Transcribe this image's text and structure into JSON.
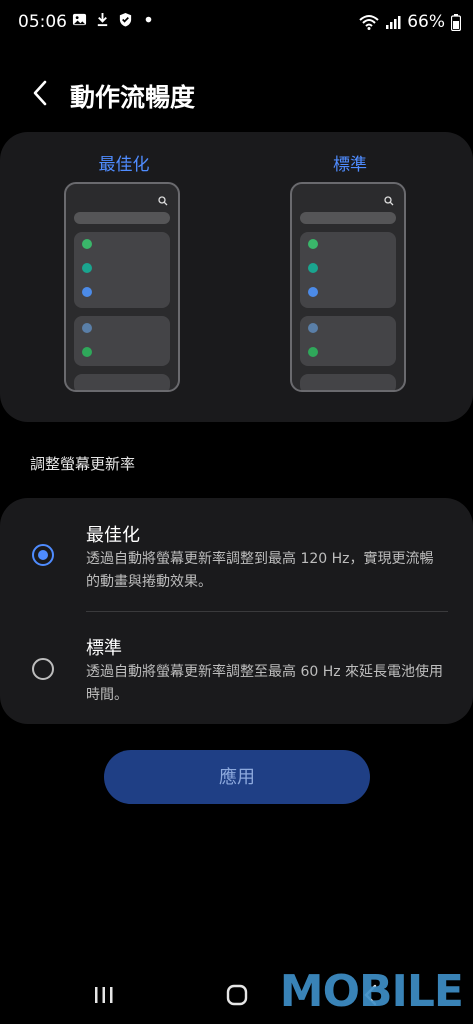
{
  "status_bar": {
    "time": "05:06",
    "battery": "66%",
    "icons": [
      "gallery-icon",
      "download-icon",
      "shield-icon",
      "dot-icon",
      "wifi-icon",
      "signal-icon",
      "battery-icon"
    ]
  },
  "header": {
    "title": "動作流暢度",
    "back_icon": "chevron-left-icon"
  },
  "preview": {
    "optimized_label": "最佳化",
    "standard_label": "標準"
  },
  "section": {
    "label": "調整螢幕更新率"
  },
  "options": [
    {
      "title": "最佳化",
      "description": "透過自動將螢幕更新率調整到最高 120 Hz，實現更流暢的動畫與捲動效果。",
      "selected": true
    },
    {
      "title": "標準",
      "description": "透過自動將螢幕更新率調整至最高 60 Hz 來延長電池使用時間。",
      "selected": false
    }
  ],
  "apply_button": {
    "label": "應用"
  },
  "navigation": {
    "icons": [
      "recents-icon",
      "home-icon",
      "back-icon"
    ]
  },
  "watermark": {
    "text": "MOBILE"
  },
  "colors": {
    "accent": "#4f8cff",
    "card_bg": "#1a1a1c",
    "button_bg": "#1f3f85",
    "preview_dot_green": "#3ab66a",
    "preview_dot_teal": "#1aa58f",
    "preview_dot_blue": "#4c8be8"
  }
}
